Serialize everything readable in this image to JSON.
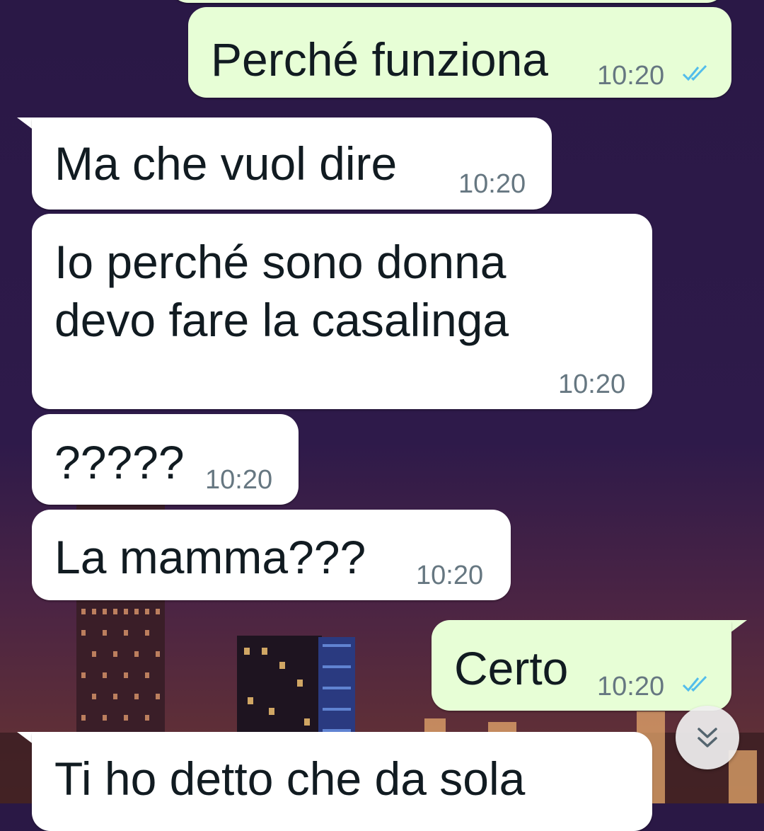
{
  "messages": [
    {
      "id": "m0",
      "direction": "outgoing",
      "text": "Perché funziona",
      "time": "10:20",
      "status": "read"
    },
    {
      "id": "m1",
      "direction": "incoming",
      "text": "Ma che vuol dire",
      "time": "10:20"
    },
    {
      "id": "m2",
      "direction": "incoming",
      "text_lines": [
        "Io perché sono donna",
        "devo fare la casalinga"
      ],
      "time": "10:20"
    },
    {
      "id": "m3",
      "direction": "incoming",
      "text": "?????",
      "time": "10:20"
    },
    {
      "id": "m4",
      "direction": "incoming",
      "text": "La mamma???",
      "time": "10:20"
    },
    {
      "id": "m5",
      "direction": "outgoing",
      "text": "Certo",
      "time": "10:20",
      "status": "read"
    },
    {
      "id": "m6",
      "direction": "incoming",
      "text": "Ti ho detto che da sola",
      "time": ""
    }
  ],
  "scroll_button": {
    "icon": "double-chevron-down-icon"
  },
  "colors": {
    "incoming_bubble": "#ffffff",
    "outgoing_bubble": "#e7fed6",
    "read_ticks": "#53bdeb",
    "timestamp": "#667781"
  }
}
